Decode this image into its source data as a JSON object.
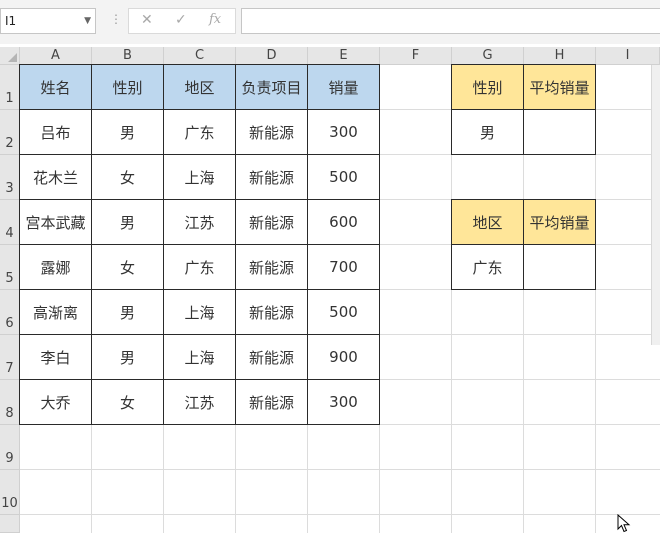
{
  "formula_bar": {
    "name_box": "I1",
    "cancel": "✕",
    "enter": "✓",
    "fx": "fx",
    "content": ""
  },
  "columns": [
    "A",
    "B",
    "C",
    "D",
    "E",
    "F",
    "G",
    "H",
    "I"
  ],
  "rows": [
    "1",
    "2",
    "3",
    "4",
    "5",
    "6",
    "7",
    "8",
    "9",
    "10"
  ],
  "table": {
    "headers": [
      "姓名",
      "性别",
      "地区",
      "负责项目",
      "销量"
    ],
    "rows": [
      [
        "吕布",
        "男",
        "广东",
        "新能源",
        "300"
      ],
      [
        "花木兰",
        "女",
        "上海",
        "新能源",
        "500"
      ],
      [
        "宫本武藏",
        "男",
        "江苏",
        "新能源",
        "600"
      ],
      [
        "露娜",
        "女",
        "广东",
        "新能源",
        "700"
      ],
      [
        "高渐离",
        "男",
        "上海",
        "新能源",
        "500"
      ],
      [
        "李白",
        "男",
        "上海",
        "新能源",
        "900"
      ],
      [
        "大乔",
        "女",
        "江苏",
        "新能源",
        "300"
      ]
    ]
  },
  "lookup1": {
    "label1": "性别",
    "label2": "平均销量",
    "value1": "男",
    "value2": ""
  },
  "lookup2": {
    "label1": "地区",
    "label2": "平均销量",
    "value1": "广东",
    "value2": ""
  },
  "colors": {
    "header_blue": "#bdd7ee",
    "header_yellow": "#ffe699"
  }
}
